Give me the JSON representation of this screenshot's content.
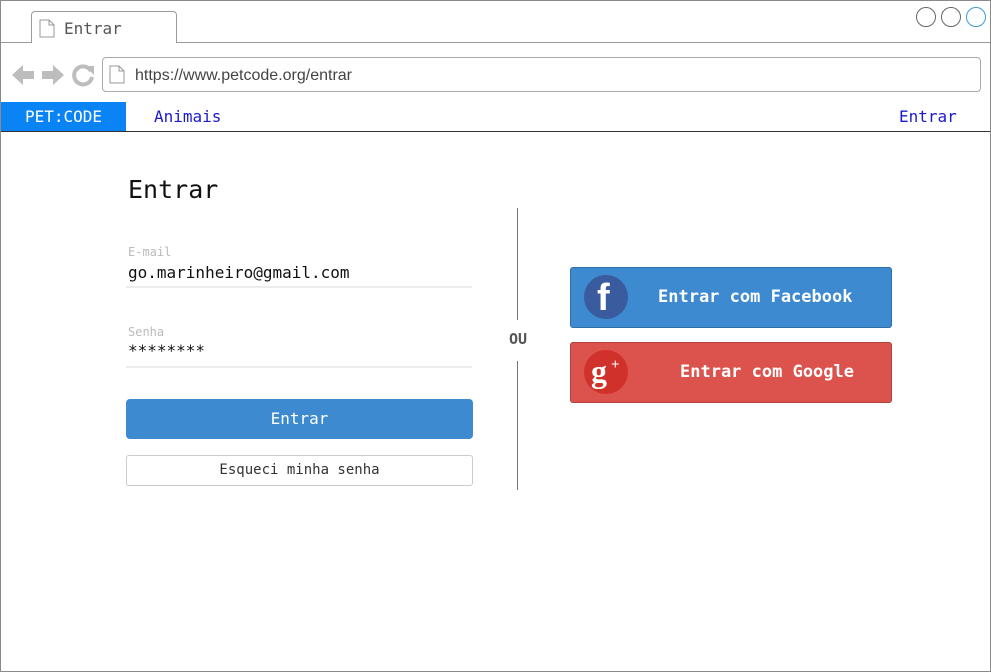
{
  "browser": {
    "tab_title": "Entrar",
    "url": "https://www.petcode.org/entrar"
  },
  "nav": {
    "brand": "PET:CODE",
    "animals_link": "Animais",
    "login_link": "Entrar"
  },
  "login": {
    "title": "Entrar",
    "email_label": "E-mail",
    "email_value": "go.marinheiro@gmail.com",
    "password_label": "Senha",
    "password_value": "********",
    "submit_label": "Entrar",
    "forgot_label": "Esqueci minha senha"
  },
  "separator": "OU",
  "social": {
    "facebook_label": "Entrar com Facebook",
    "google_label": "Entrar com Google",
    "facebook_icon": "facebook-icon",
    "google_icon": "google-plus-icon"
  },
  "colors": {
    "brand": "#0a84f4",
    "primary_button": "#3d8ad0",
    "facebook": "#3a5b9d",
    "google": "#dc524d"
  }
}
